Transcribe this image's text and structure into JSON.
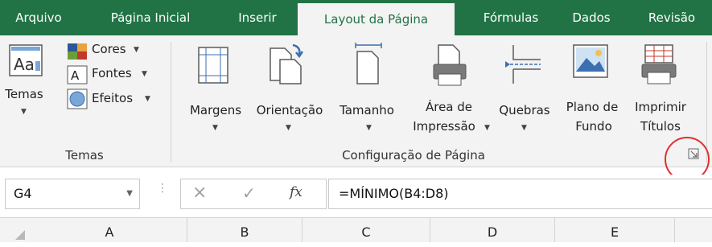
{
  "tabs": [
    "Arquivo",
    "Página Inicial",
    "Inserir",
    "Layout da Página",
    "Fórmulas",
    "Dados",
    "Revisão"
  ],
  "active_tab": "Layout da Página",
  "temas_group": {
    "temas_label_1": "Temas",
    "cores": "Cores",
    "fontes": "Fontes",
    "efeitos": "Efeitos",
    "group_label": "Temas"
  },
  "config_group": {
    "margens": "Margens",
    "orientacao": "Orientação",
    "tamanho": "Tamanho",
    "area_1": "Área de",
    "area_2": "Impressão",
    "quebras": "Quebras",
    "plano_1": "Plano de",
    "plano_2": "Fundo",
    "imprimir_1": "Imprimir",
    "imprimir_2": "Títulos",
    "group_label": "Configuração de Página"
  },
  "formula_bar": {
    "name_box": "G4",
    "cancel_icon": "×",
    "enter_icon": "✓",
    "fx_icon": "fx",
    "formula": "=MÍNIMO(B4:D8)"
  },
  "columns": [
    "A",
    "B",
    "C",
    "D",
    "E"
  ],
  "colors": {
    "excel_green": "#217346",
    "highlight_circle": "#e03030"
  }
}
